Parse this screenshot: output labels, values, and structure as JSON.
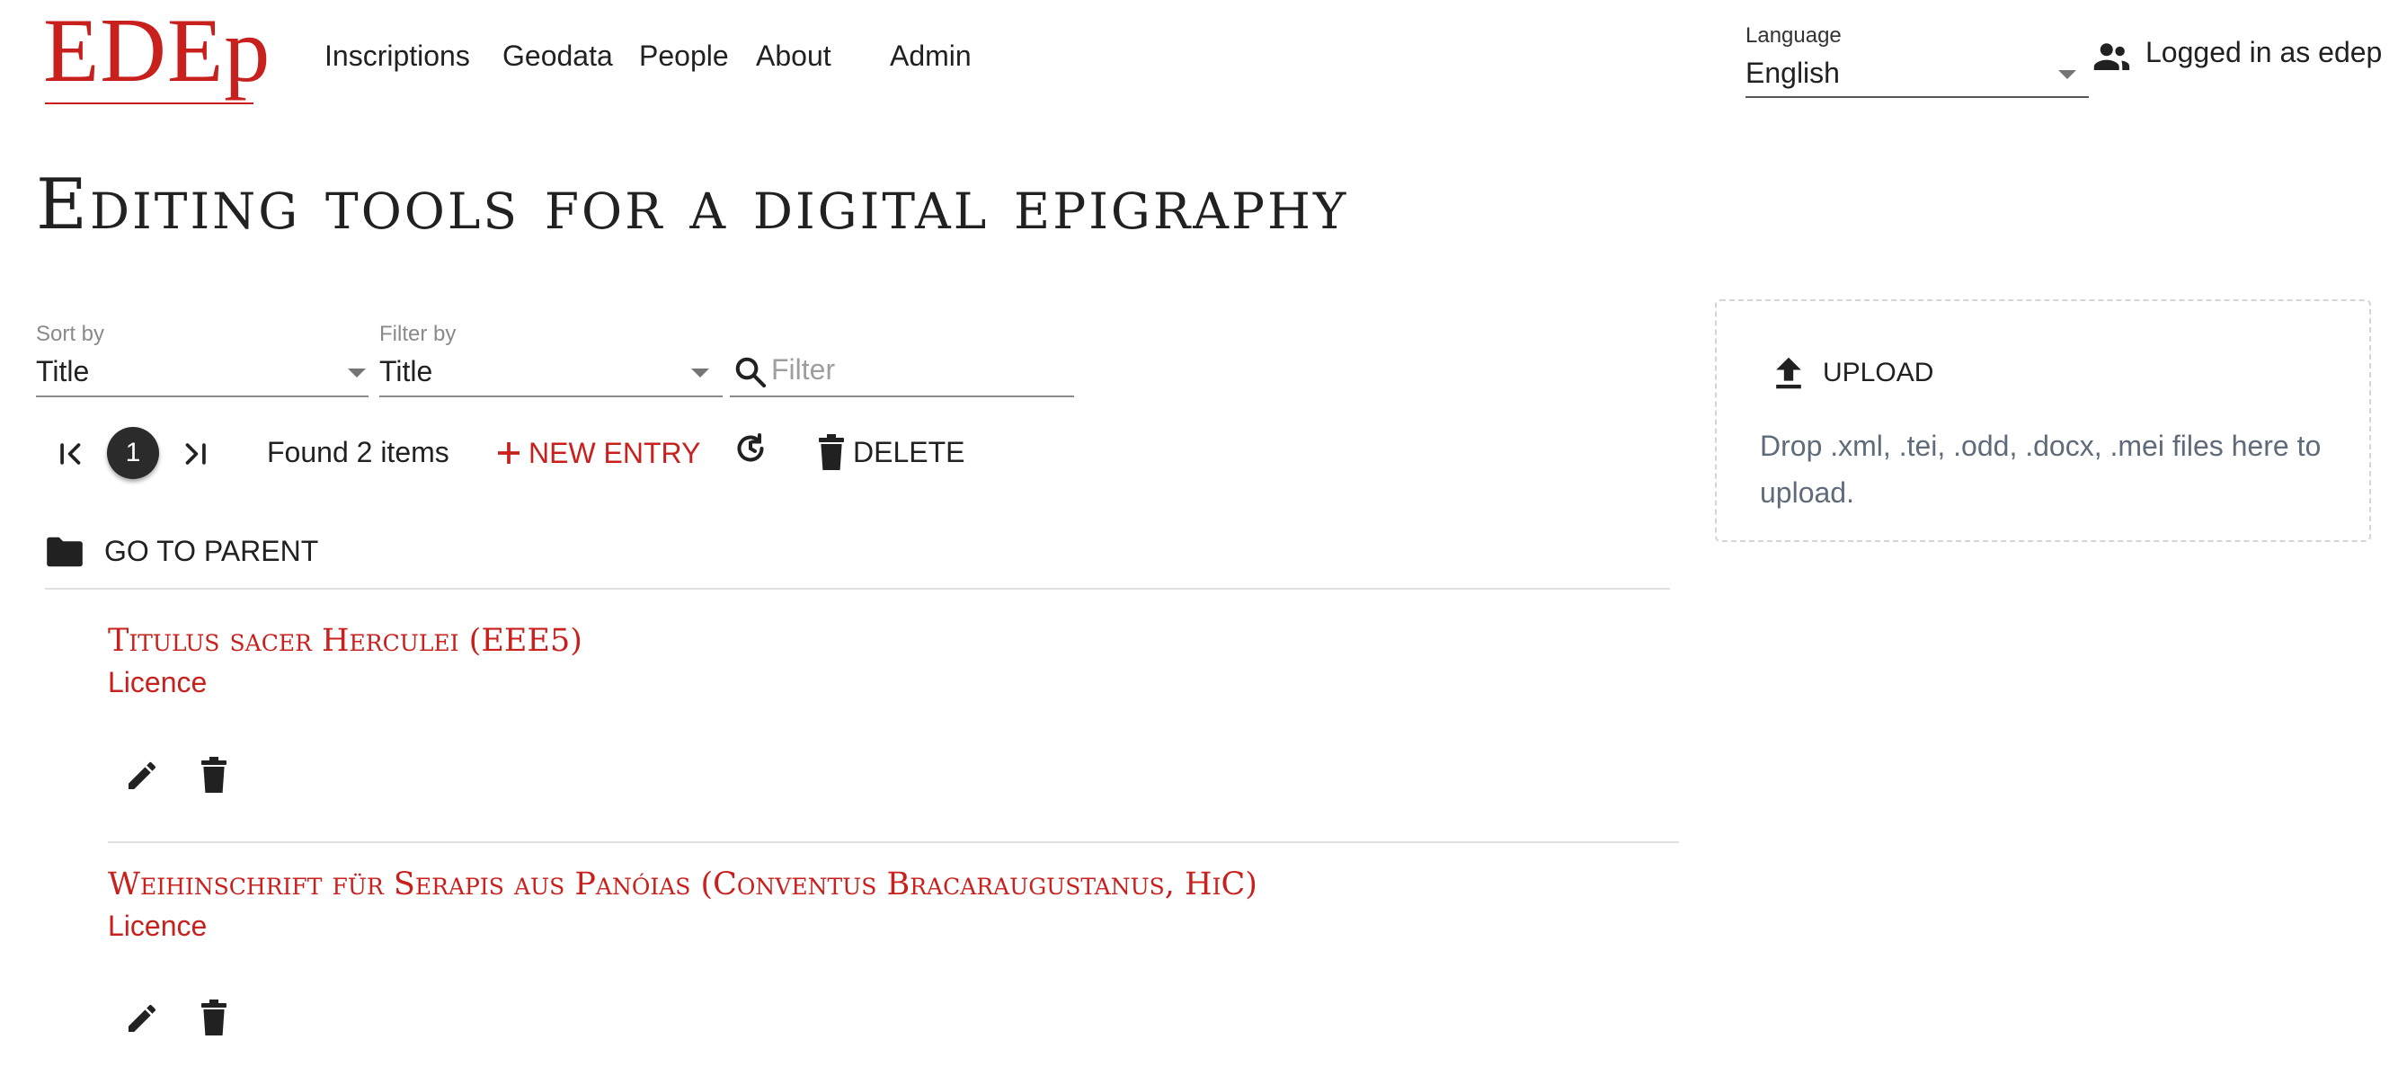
{
  "header": {
    "logo": "EDEp",
    "nav": {
      "inscriptions": "Inscriptions",
      "geodata": "Geodata",
      "people": "People",
      "about": "About",
      "admin": "Admin"
    },
    "language": {
      "label": "Language",
      "value": "English"
    },
    "login_text": "Logged in as edep"
  },
  "page_title": "Editing tools for a digital epigraphy",
  "filters": {
    "sort_label": "Sort by",
    "sort_value": "Title",
    "filter_by_label": "Filter by",
    "filter_by_value": "Title",
    "filter_placeholder": "Filter"
  },
  "toolbar": {
    "current_page": "1",
    "found_text": "Found 2 items",
    "new_entry_label": "NEW ENTRY",
    "delete_label": "DELETE"
  },
  "go_to_parent_label": "GO TO PARENT",
  "items": [
    {
      "title": "Titulus sacer Herculei (EEE5)",
      "licence": "Licence"
    },
    {
      "title": "Weihinschrift für Serapis aus Panóias (Conventus Bracaraugustanus, HiC)",
      "licence": "Licence"
    }
  ],
  "upload": {
    "button_label": "UPLOAD",
    "hint": "Drop .xml, .tei, .odd, .docx, .mei files here to upload."
  },
  "icons": [
    "user-group-icon",
    "search-icon",
    "first-page-icon",
    "last-page-icon",
    "plus-icon",
    "refresh-icon",
    "trash-icon",
    "folder-icon",
    "pencil-icon",
    "upload-icon",
    "chevron-down-icon"
  ],
  "colors": {
    "accent": "#c8201d",
    "text": "#212121",
    "muted": "#8a8a8a"
  }
}
